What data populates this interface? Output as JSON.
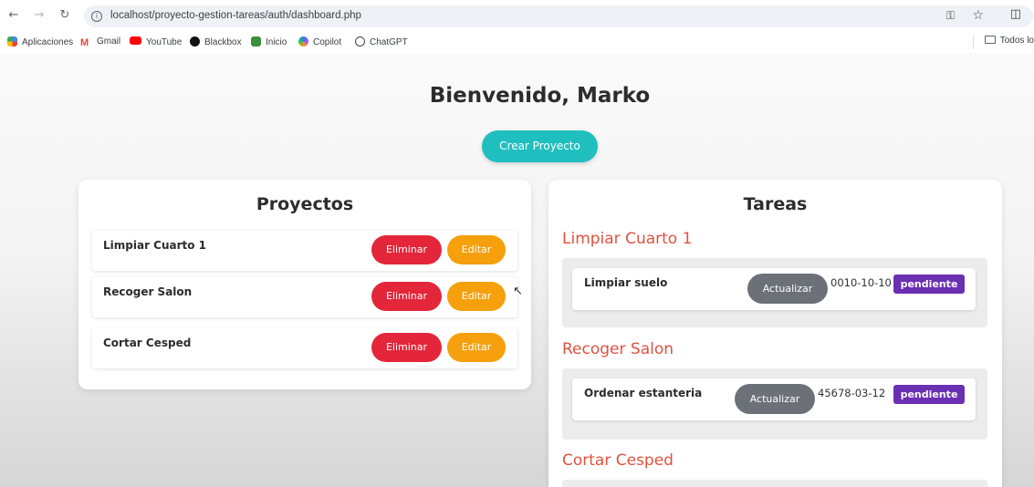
{
  "browser": {
    "url": "localhost/proyecto-gestion-tareas/auth/dashboard.php",
    "bookmarks": [
      "Aplicaciones",
      "Gmail",
      "YouTube",
      "Blackbox",
      "Inicio",
      "Copilot",
      "ChatGPT"
    ],
    "bookmarks_folder": "Todos lo"
  },
  "header": {
    "welcome": "Bienvenido, Marko",
    "create_project": "Crear Proyecto"
  },
  "projects": {
    "title": "Proyectos",
    "delete_label": "Eliminar",
    "edit_label": "Editar",
    "items": [
      {
        "name": "Limpiar Cuarto 1"
      },
      {
        "name": "Recoger Salon"
      },
      {
        "name": "Cortar Cesped"
      }
    ]
  },
  "tasks": {
    "title": "Tareas",
    "update_label": "Actualizar",
    "groups": [
      {
        "project": "Limpiar Cuarto 1",
        "tasks": [
          {
            "name": "Limpiar suelo",
            "date": "0010-10-10",
            "status": "pendiente"
          }
        ]
      },
      {
        "project": "Recoger Salon",
        "tasks": [
          {
            "name": "Ordenar estanteria",
            "date": "45678-03-12",
            "status": "pendiente"
          }
        ]
      },
      {
        "project": "Cortar Cesped",
        "tasks": []
      }
    ]
  },
  "colors": {
    "accent": "#20bfbf",
    "delete": "#e3263a",
    "edit": "#f5a00c",
    "update": "#6c7178",
    "badge": "#6a2fb3",
    "project_heading": "#e0523f"
  }
}
